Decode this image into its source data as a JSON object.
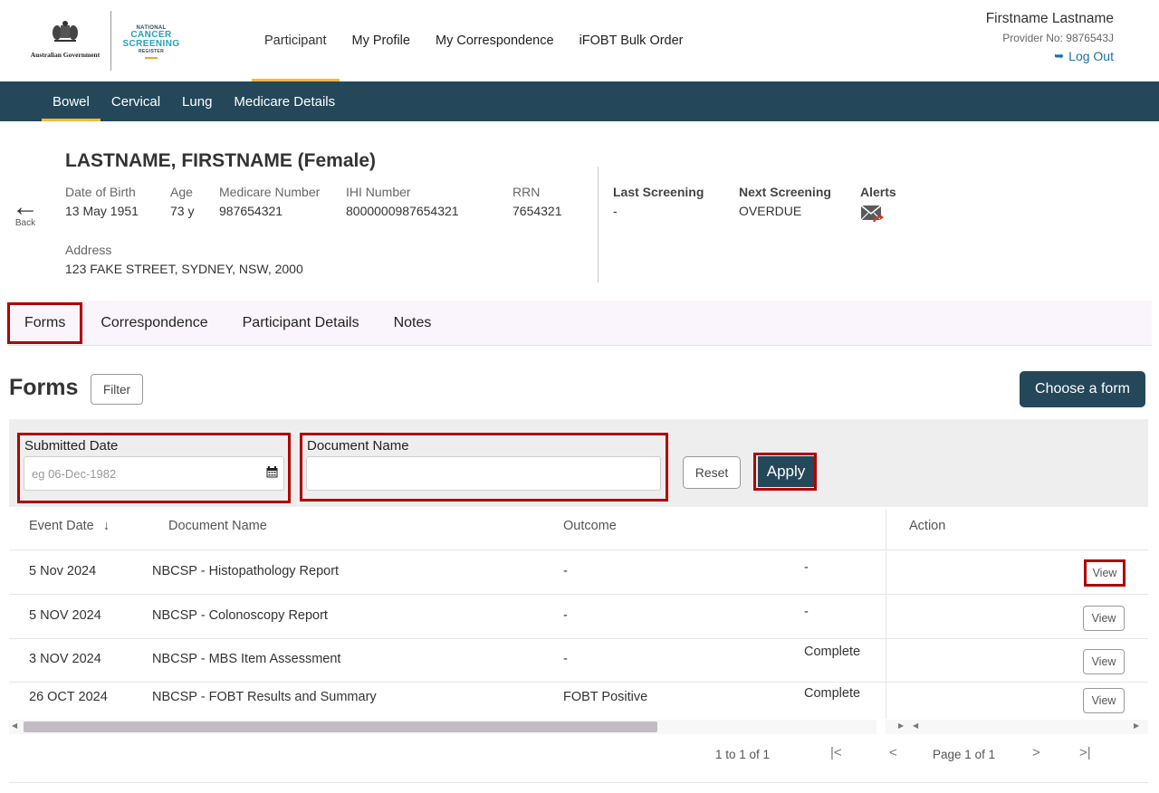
{
  "header": {
    "gov_text": "Australian Government",
    "ncsr": {
      "line1": "NATIONAL",
      "line2a": "CANCER",
      "line2b": "SCREENING",
      "line3": "REGISTER"
    },
    "nav": [
      "Participant",
      "My Profile",
      "My Correspondence",
      "iFOBT Bulk Order"
    ],
    "active_nav": "Participant",
    "user_name": "Firstname Lastname",
    "provider_no": "Provider No: 9876543J",
    "logout_label": "Log Out"
  },
  "subnav": [
    "Bowel",
    "Cervical",
    "Lung",
    "Medicare Details"
  ],
  "active_subnav": "Bowel",
  "participant": {
    "back_label": "Back",
    "name": "LASTNAME, FIRSTNAME (Female)",
    "dob_label": "Date of Birth",
    "dob": "13 May 1951",
    "age_label": "Age",
    "age": "73 y",
    "medicare_label": "Medicare Number",
    "medicare": "987654321",
    "ihi_label": "IHI Number",
    "ihi": "8000000987654321",
    "rrn_label": "RRN",
    "rrn": "7654321",
    "address_label": "Address",
    "address": "123 FAKE STREET, SYDNEY, NSW, 2000",
    "last_screening_label": "Last Screening",
    "last_screening": "-",
    "next_screening_label": "Next Screening",
    "next_screening": "OVERDUE",
    "alerts_label": "Alerts"
  },
  "tabs": [
    "Forms",
    "Correspondence",
    "Participant Details",
    "Notes"
  ],
  "forms": {
    "title": "Forms",
    "filter_label": "Filter",
    "choose_label": "Choose a form",
    "submitted_date_label": "Submitted Date",
    "submitted_date_placeholder": "eg 06-Dec-1982",
    "document_name_label": "Document Name",
    "document_name_value": "",
    "reset_label": "Reset",
    "apply_label": "Apply"
  },
  "table": {
    "headers": {
      "event_date": "Event Date",
      "document_name": "Document Name",
      "outcome": "Outcome",
      "action": "Action"
    },
    "sort_indicator": "↓",
    "rows": [
      {
        "date": "5 Nov 2024",
        "doc": "NBCSP - Histopathology Report",
        "outcome": "-",
        "status": "-",
        "action": "View"
      },
      {
        "date": "5 NOV 2024",
        "doc": "NBCSP - Colonoscopy Report",
        "outcome": "-",
        "status": "-",
        "action": "View"
      },
      {
        "date": "3 NOV 2024",
        "doc": "NBCSP - MBS Item Assessment",
        "outcome": "-",
        "status": "Complete",
        "action": "View"
      },
      {
        "date": "26 OCT 2024",
        "doc": "NBCSP - FOBT Results and Summary",
        "outcome": "FOBT Positive",
        "status": "Complete",
        "action": "View"
      }
    ]
  },
  "pagination": {
    "range": "1 to 1 of 1",
    "first": "|<",
    "prev": "<",
    "page_word": "Page",
    "page": "1",
    "of_word": "of",
    "total": "1",
    "next": ">",
    "last": ">|"
  },
  "colors": {
    "primary": "#24475a",
    "accent": "#f5b942",
    "highlight": "#b00000",
    "link": "#1d6fa8"
  }
}
